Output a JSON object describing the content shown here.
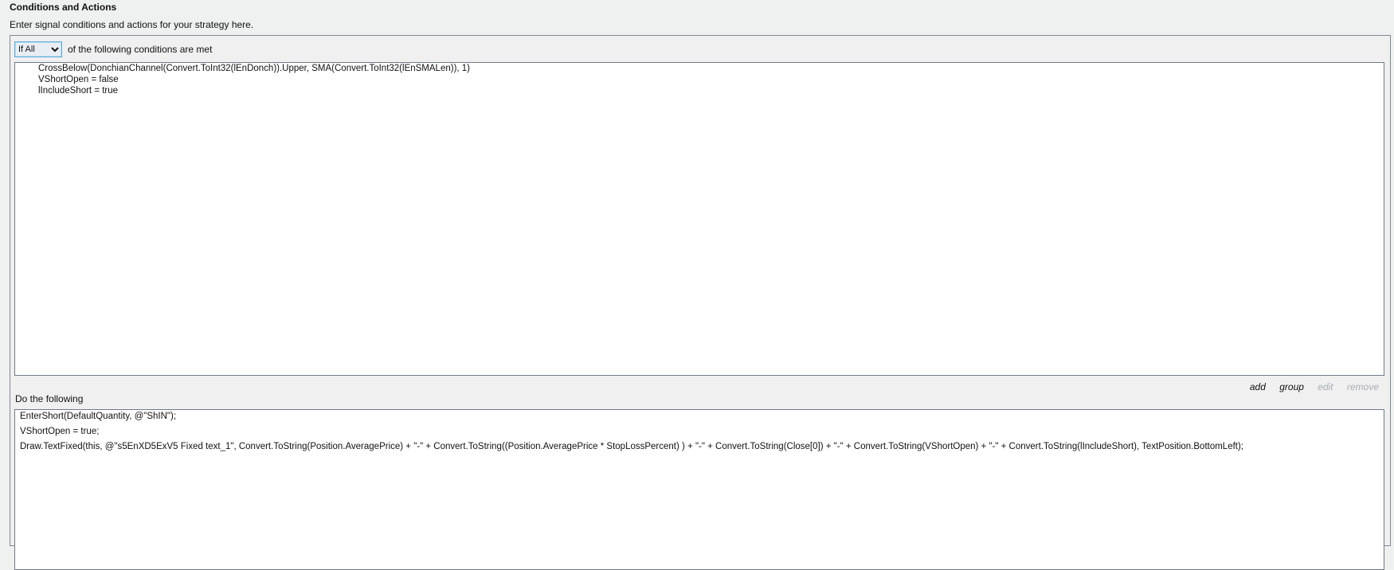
{
  "header": {
    "title": "Conditions and Actions",
    "subtitle": "Enter signal conditions and actions for your strategy here."
  },
  "conditions": {
    "mode_selected": "If All",
    "suffix": "of the following conditions are met",
    "lines": [
      "CrossBelow(DonchianChannel(Convert.ToInt32(lEnDonch)).Upper, SMA(Convert.ToInt32(lEnSMALen)), 1)",
      "VShortOpen = false",
      "lIncludeShort = true"
    ]
  },
  "links": {
    "add": "add",
    "group": "group",
    "edit": "edit",
    "remove": "remove"
  },
  "actions": {
    "label": "Do the following",
    "lines": [
      "EnterShort(DefaultQuantity, @\"ShIN\");",
      "VShortOpen = true;",
      "Draw.TextFixed(this, @\"s5EnXD5ExV5 Fixed text_1\", Convert.ToString(Position.AveragePrice) + \"-\" + Convert.ToString((Position.AveragePrice * StopLossPercent) ) + \"-\" + Convert.ToString(Close[0]) + \"-\" + Convert.ToString(VShortOpen) + \"-\" + Convert.ToString(lIncludeShort), TextPosition.BottomLeft);"
    ]
  },
  "icons": {
    "select_arrow": "chevron-down-icon"
  }
}
